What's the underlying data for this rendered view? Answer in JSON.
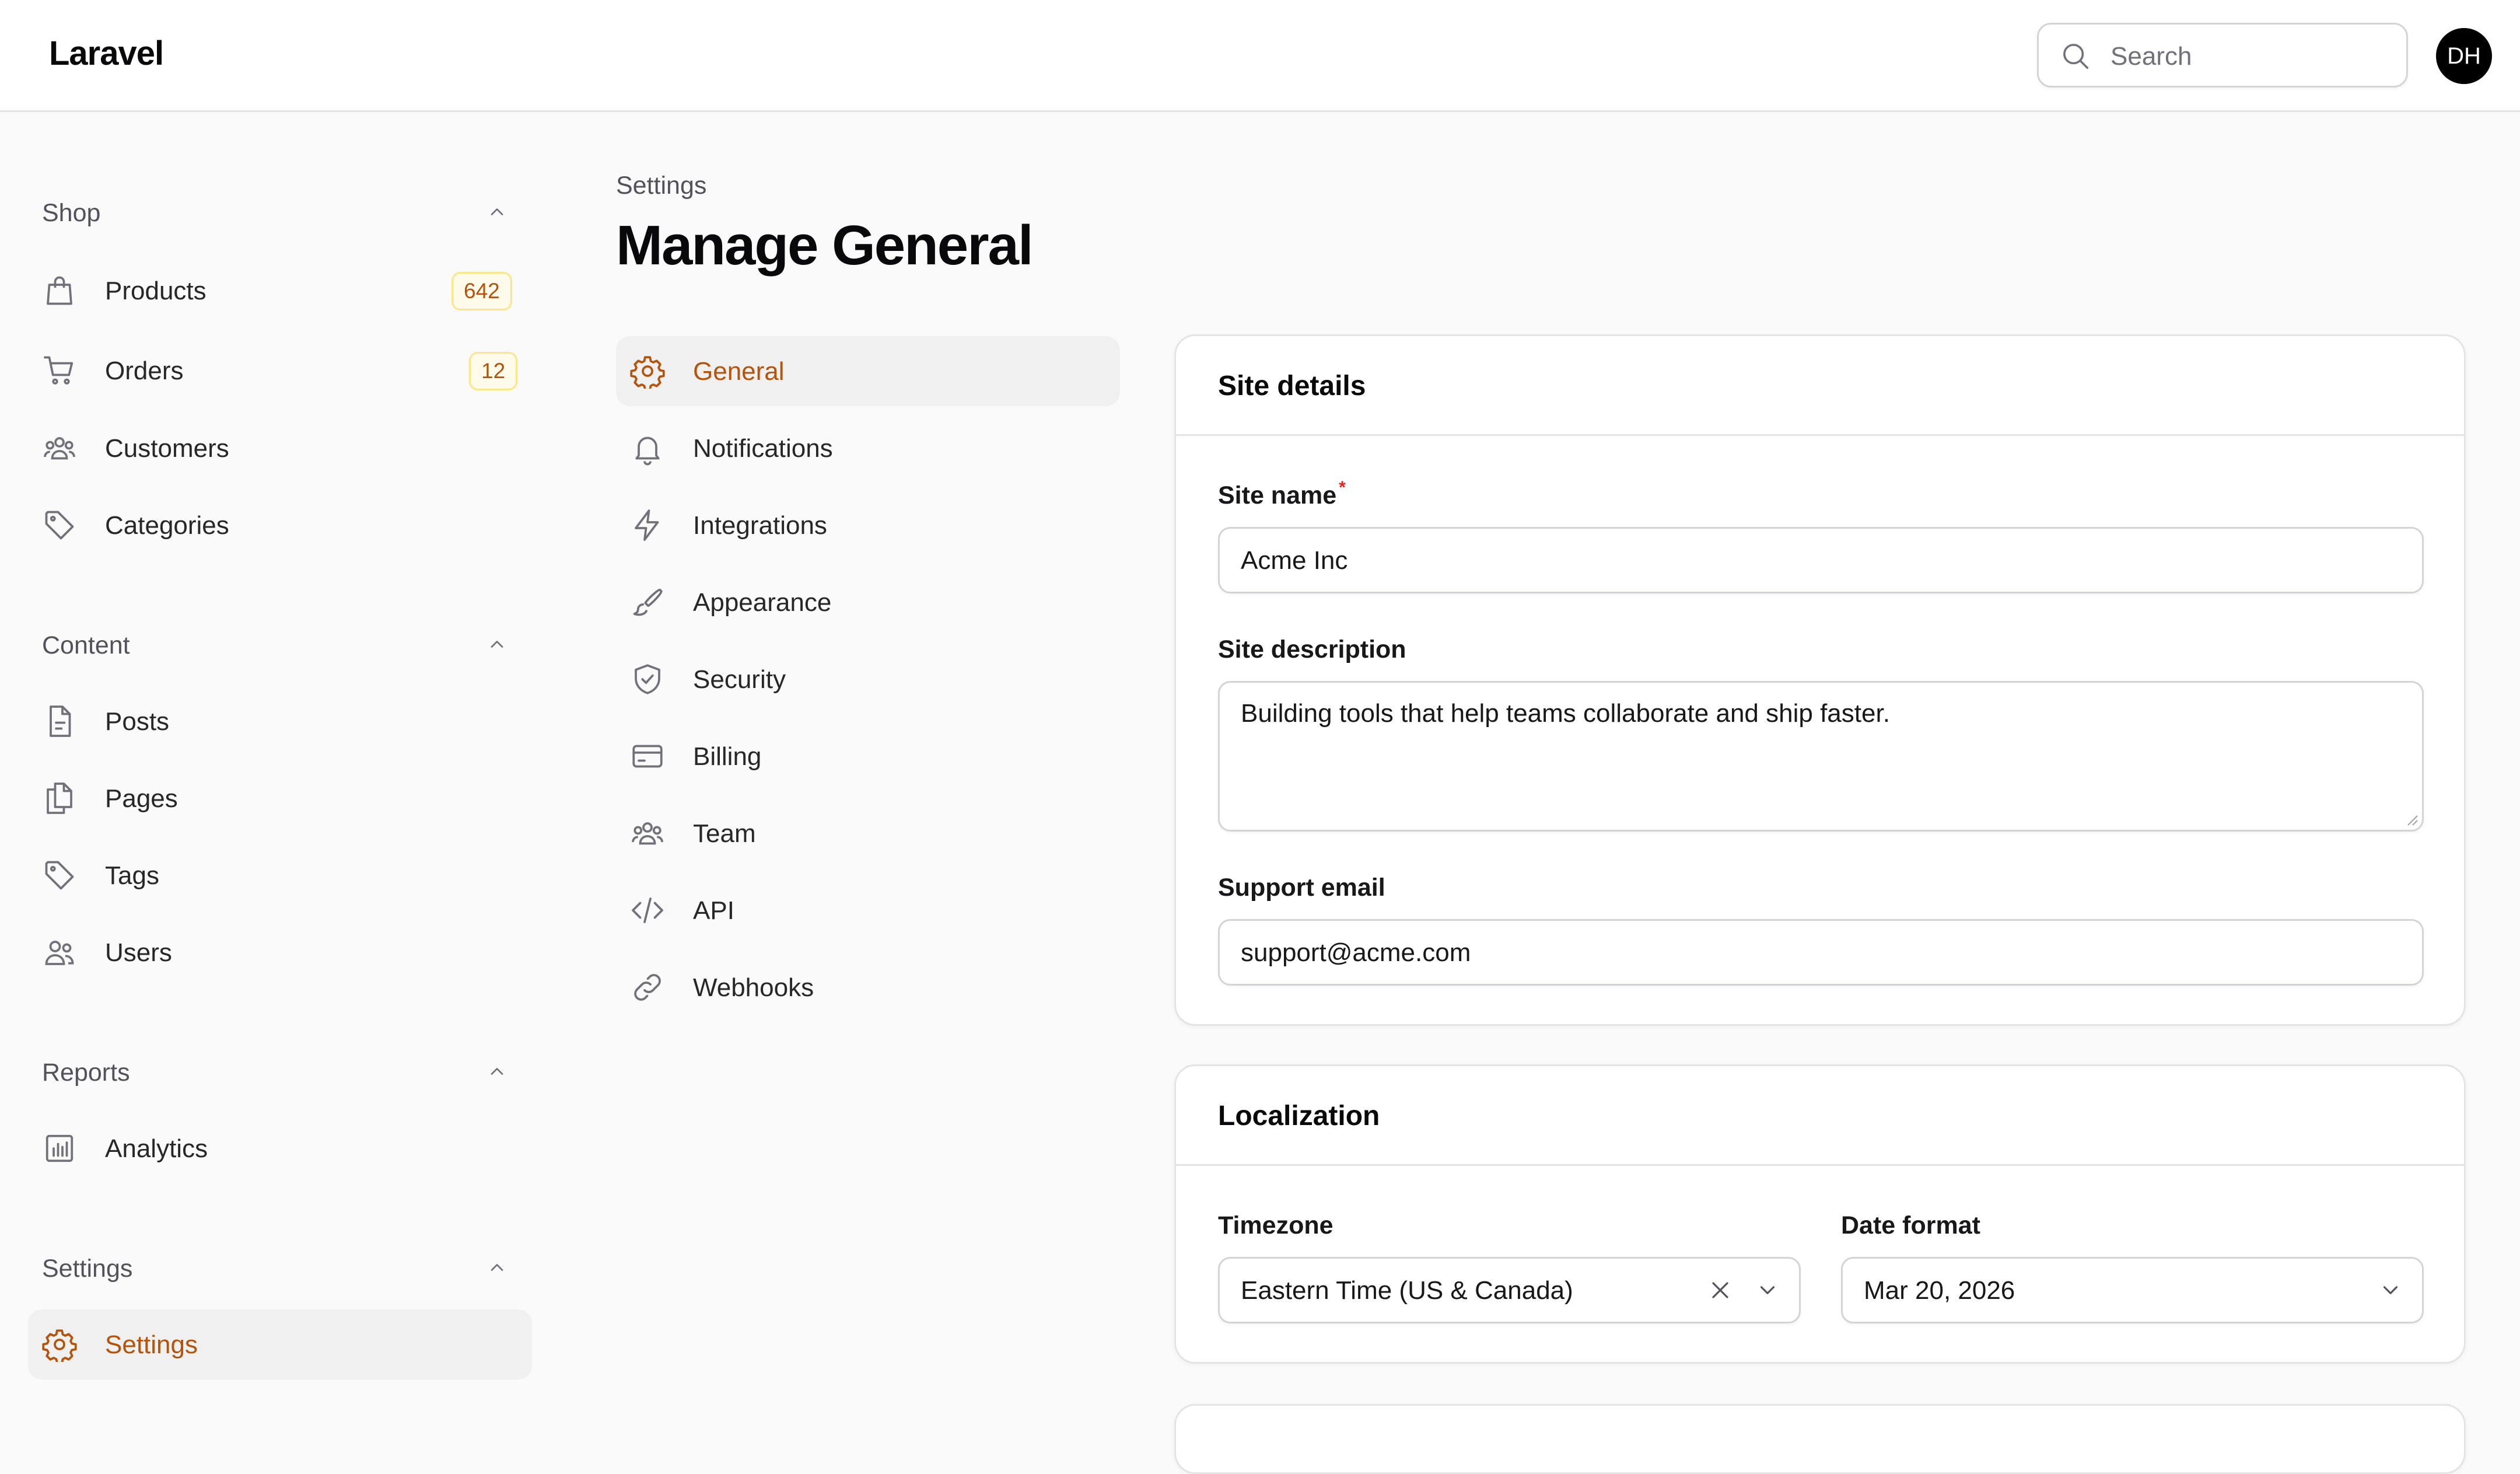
{
  "app": {
    "logo": "Laravel",
    "avatar_initials": "DH",
    "accent_color": "#b45309"
  },
  "search": {
    "placeholder": "Search"
  },
  "sidebar": {
    "groups": [
      {
        "title": "Shop",
        "items": [
          {
            "label": "Products",
            "icon": "shopping-bag-icon",
            "badge": "642"
          },
          {
            "label": "Orders",
            "icon": "shopping-cart-icon",
            "badge": "12"
          },
          {
            "label": "Customers",
            "icon": "user-group-icon"
          },
          {
            "label": "Categories",
            "icon": "tag-icon"
          }
        ]
      },
      {
        "title": "Content",
        "items": [
          {
            "label": "Posts",
            "icon": "document-icon"
          },
          {
            "label": "Pages",
            "icon": "documents-icon"
          },
          {
            "label": "Tags",
            "icon": "tag-icon"
          },
          {
            "label": "Users",
            "icon": "users-icon"
          }
        ]
      },
      {
        "title": "Reports",
        "items": [
          {
            "label": "Analytics",
            "icon": "chart-bar-icon"
          }
        ]
      },
      {
        "title": "Settings",
        "items": [
          {
            "label": "Settings",
            "icon": "cog-icon",
            "active": true
          }
        ]
      }
    ]
  },
  "page": {
    "breadcrumb": "Settings",
    "title": "Manage General"
  },
  "subnav": {
    "items": [
      {
        "label": "General",
        "icon": "cog-icon",
        "active": true
      },
      {
        "label": "Notifications",
        "icon": "bell-icon"
      },
      {
        "label": "Integrations",
        "icon": "bolt-icon"
      },
      {
        "label": "Appearance",
        "icon": "paint-brush-icon"
      },
      {
        "label": "Security",
        "icon": "shield-check-icon"
      },
      {
        "label": "Billing",
        "icon": "credit-card-icon"
      },
      {
        "label": "Team",
        "icon": "user-group-icon"
      },
      {
        "label": "API",
        "icon": "code-icon"
      },
      {
        "label": "Webhooks",
        "icon": "link-icon"
      }
    ]
  },
  "site_details": {
    "title": "Site details",
    "site_name": {
      "label": "Site name",
      "required_mark": "*",
      "value": "Acme Inc"
    },
    "site_description": {
      "label": "Site description",
      "value": "Building tools that help teams collaborate and ship faster."
    },
    "support_email": {
      "label": "Support email",
      "value": "support@acme.com"
    }
  },
  "localization": {
    "title": "Localization",
    "timezone": {
      "label": "Timezone",
      "value": "Eastern Time (US & Canada)"
    },
    "date_format": {
      "label": "Date format",
      "value": "Mar 20, 2026"
    }
  }
}
